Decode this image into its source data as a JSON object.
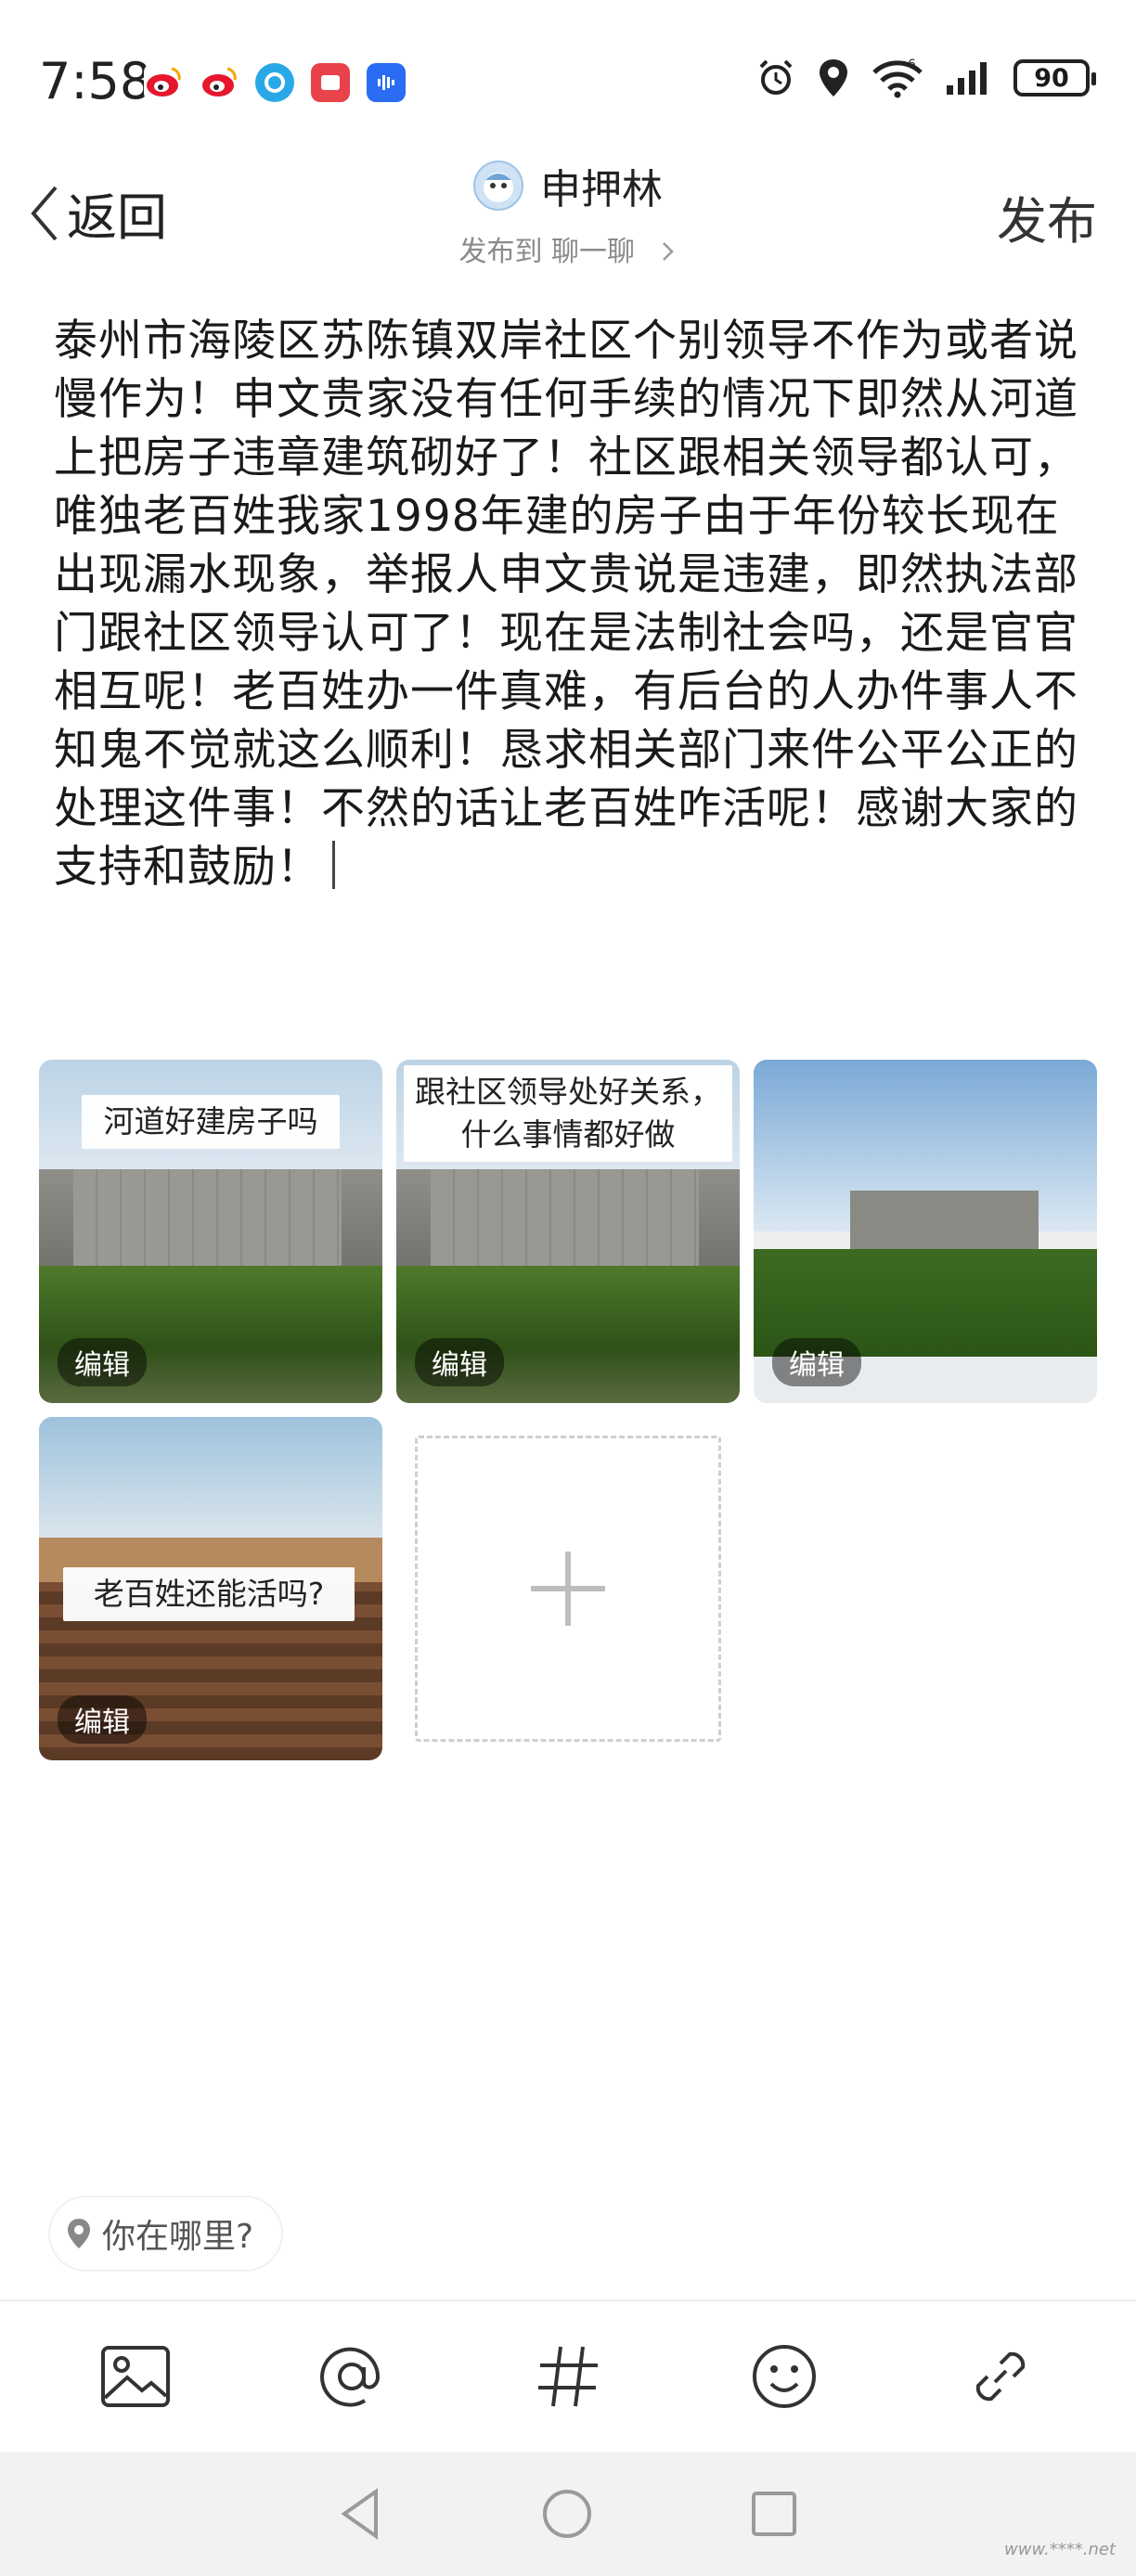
{
  "status_bar": {
    "time": "7:58",
    "battery": "90",
    "network": "6"
  },
  "header": {
    "back_label": "返回",
    "user_name": "申押林",
    "post_to": "发布到 聊一聊",
    "publish_label": "发布"
  },
  "post": {
    "text": "泰州市海陵区苏陈镇双岸社区个别领导不作为或者说慢作为！申文贵家没有任何手续的情况下即然从河道上把房子违章建筑砌好了！社区跟相关领导都认可，唯独老百姓我家1998年建的房子由于年份较长现在出现漏水现象，举报人申文贵说是违建，即然执法部门跟社区领导认可了！现在是法制社会吗，还是官官相互呢！老百姓办一件真难，有后台的人办件事人不知鬼不觉就这么顺利！恳求相关部门来件公平公正的处理这件事！不然的话让老百姓咋活呢！感谢大家的支持和鼓励！"
  },
  "images": [
    {
      "caption": "河道好建房子吗",
      "edit_label": "编辑"
    },
    {
      "caption": "跟社区领导处好关系，什么事情都好做",
      "edit_label": "编辑"
    },
    {
      "caption": "",
      "edit_label": "编辑"
    },
    {
      "caption": "老百姓还能活吗?",
      "edit_label": "编辑"
    }
  ],
  "location": {
    "placeholder": "你在哪里?"
  },
  "toolbar": {
    "items": [
      "image-icon",
      "at-icon",
      "hashtag-icon",
      "emoji-icon",
      "link-icon"
    ]
  },
  "watermark": "www.****.net"
}
